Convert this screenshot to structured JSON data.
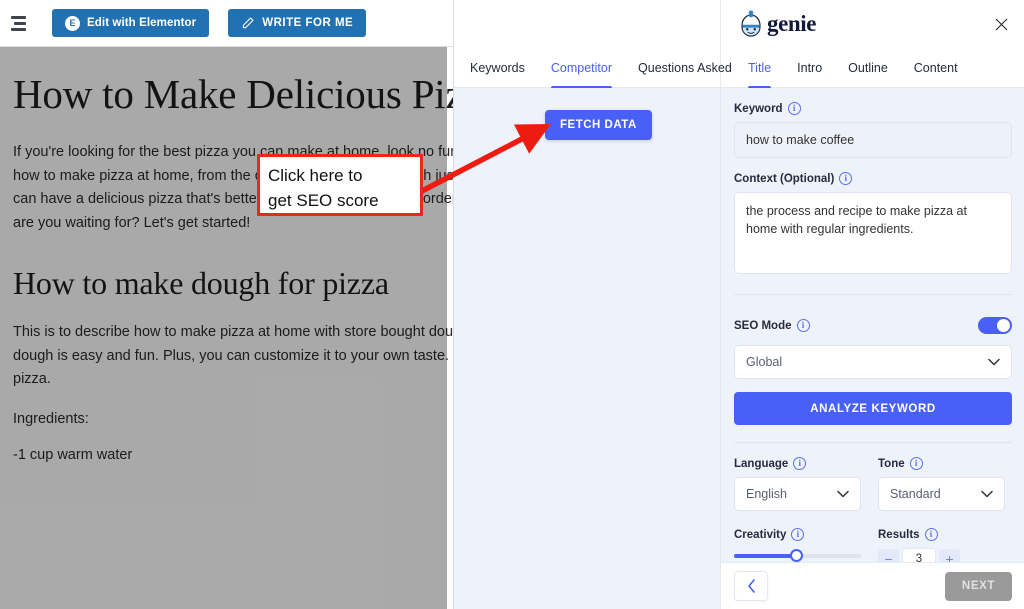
{
  "wp_toolbar": {
    "collapse_icon": "collapse-menu-icon",
    "elementor_button": "Edit with Elementor",
    "elementor_badge": "E",
    "write_button": "WRITE FOR ME"
  },
  "document": {
    "title": "How to Make Delicious Pizza at Home",
    "paragraph1": "If you're looking for the best pizza you can make at home, look no further. This guide will show you how to make pizza at home, from the dough to the toppings. With just a few simple ingredients, you can have a delicious pizza that's better than anything you could order from a restaurant. So what are you waiting for? Let's get started!",
    "heading2": "How to make dough for pizza",
    "paragraph2": "This is to describe how to make pizza at home with store bought dough. Making your own pizza dough is easy and fun. Plus, you can customize it to your own taste. Here's how to make dough for pizza.",
    "ingredients_label": "Ingredients:",
    "ingredient1": "-1 cup warm water"
  },
  "drawer": {
    "brand_name": "genie",
    "close_label": "×",
    "left_tabs": [
      {
        "label": "Keywords",
        "active": false
      },
      {
        "label": "Competitor",
        "active": true
      },
      {
        "label": "Questions Asked",
        "active": false
      }
    ],
    "right_tabs": [
      {
        "label": "Title",
        "active": true
      },
      {
        "label": "Intro",
        "active": false
      },
      {
        "label": "Outline",
        "active": false
      },
      {
        "label": "Content",
        "active": false
      }
    ],
    "competitor_pane": {
      "fetch_button": "FETCH DATA"
    },
    "form": {
      "keyword_label": "Keyword",
      "keyword_value": "how to make coffee",
      "keyword_placeholder": "how to make coffee",
      "context_label": "Context (Optional)",
      "context_value": "the process and recipe to make pizza at home with regular ingredients.",
      "seo_mode_label": "SEO Mode",
      "seo_mode_on": true,
      "region_value": "Global",
      "analyze_button": "ANALYZE KEYWORD",
      "language_label": "Language",
      "language_value": "English",
      "tone_label": "Tone",
      "tone_value": "Standard",
      "creativity_label": "Creativity",
      "creativity_percent": 48,
      "results_label": "Results",
      "results_value": "3",
      "minus_label": "−",
      "plus_label": "+"
    },
    "bottom_bar": {
      "back_label": "‹",
      "next_label": "NEXT",
      "next_disabled": true
    }
  },
  "annotation": {
    "text_line1": "Click here to",
    "text_line2": "get SEO score",
    "border_color": "#e8291f",
    "arrow_color": "#ee1c10"
  },
  "colors": {
    "accent_blue": "#4860f5",
    "wp_blue": "#2271b1",
    "panel_bg": "#eef2fb",
    "disabled_gray": "#9a9a9a"
  }
}
